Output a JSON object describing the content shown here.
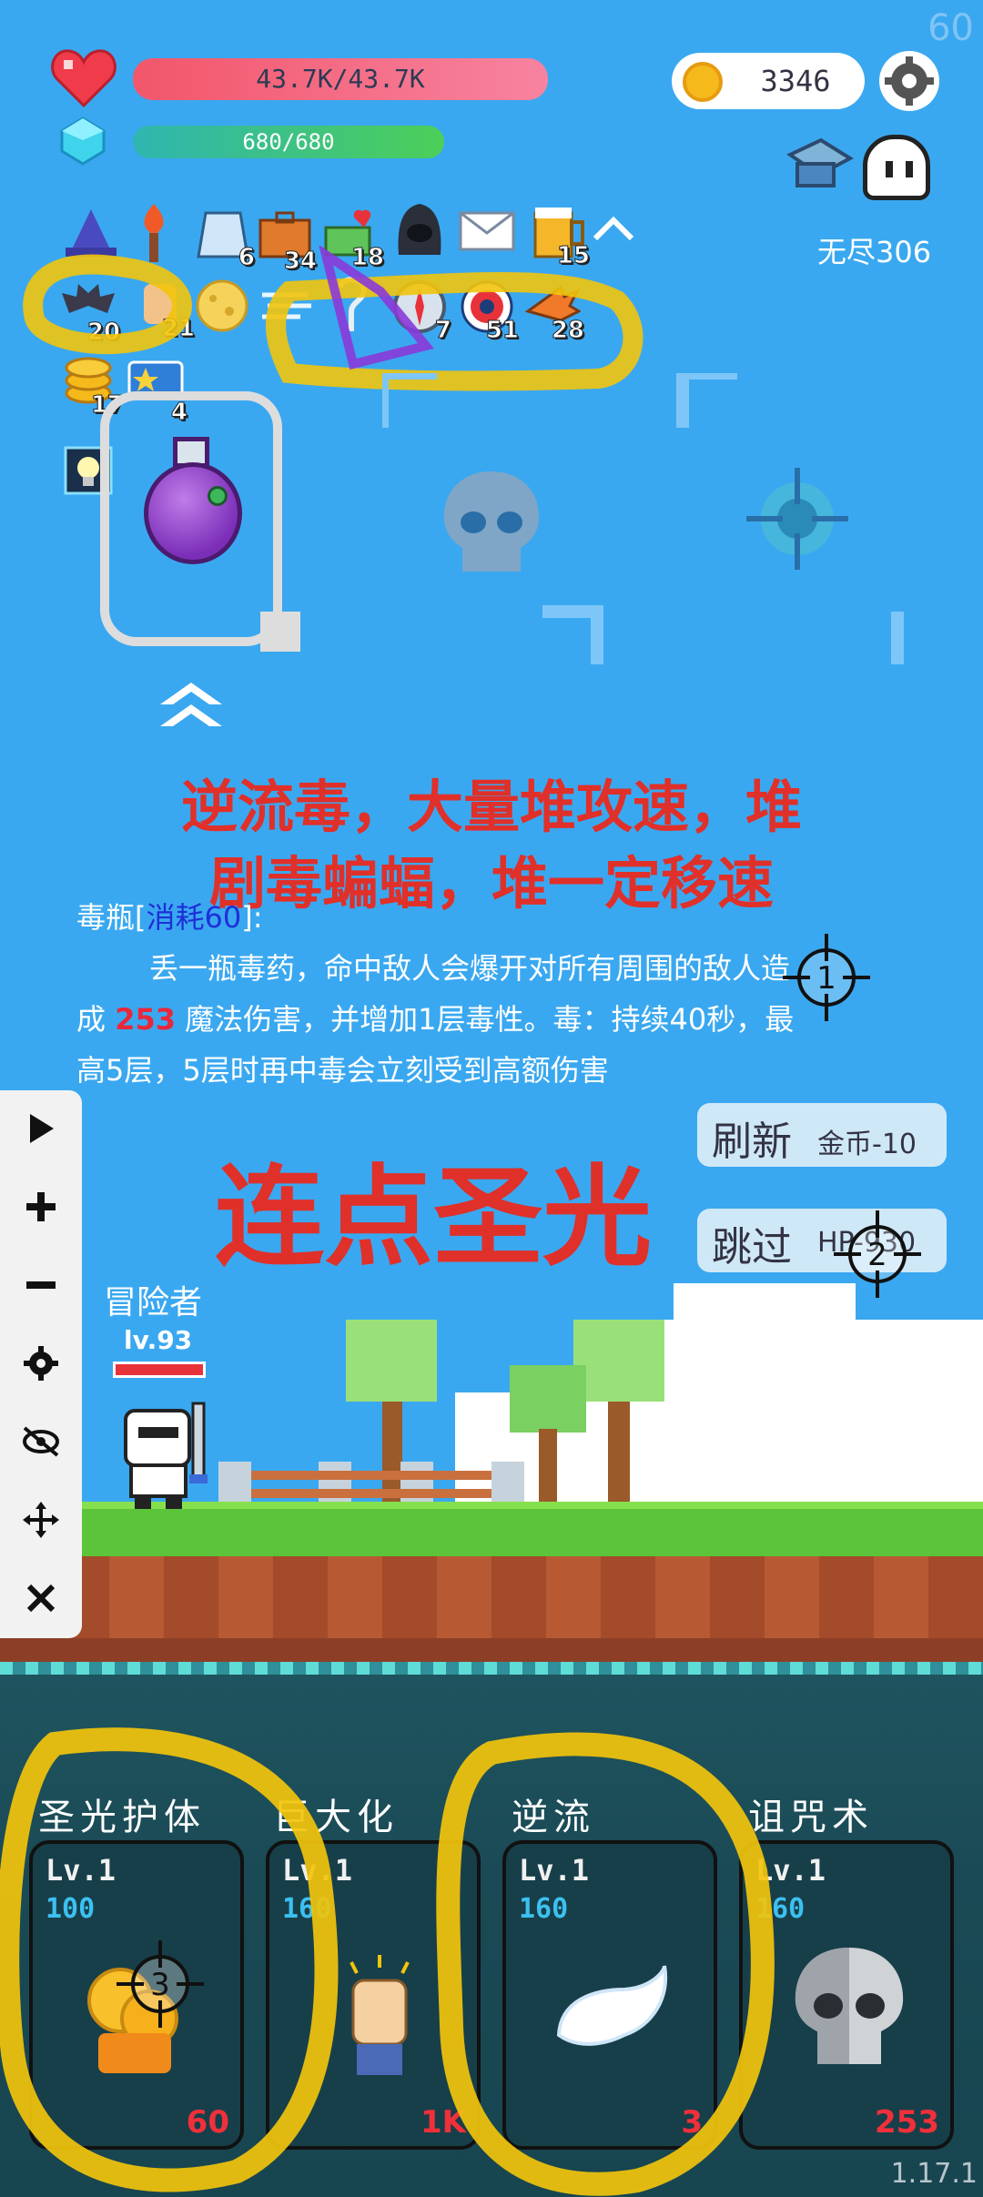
{
  "hud": {
    "fps": "60",
    "hp_text": "43.7K/43.7K",
    "mp_text": "680/680",
    "coins": "3346",
    "mode_label": "无尽306"
  },
  "items_row1": [
    {
      "icon": "wizard-hat-icon",
      "count": ""
    },
    {
      "icon": "flame-staff-icon",
      "count": ""
    },
    {
      "icon": "robe-icon",
      "count": "6"
    },
    {
      "icon": "briefcase-icon",
      "count": "34"
    },
    {
      "icon": "money-heart-icon",
      "count": "18"
    },
    {
      "icon": "hood-icon",
      "count": ""
    },
    {
      "icon": "envelope-icon",
      "count": ""
    },
    {
      "icon": "beer-icon",
      "count": "15"
    }
  ],
  "items_row2": [
    {
      "icon": "bat-icon",
      "count": "20"
    },
    {
      "icon": "fist-icon",
      "count": "21"
    },
    {
      "icon": "moon-cookie-icon",
      "count": ""
    },
    {
      "icon": "wind-icon",
      "count": ""
    },
    {
      "icon": "hook-icon",
      "count": ""
    },
    {
      "icon": "compass-icon",
      "count": "7"
    },
    {
      "icon": "target-icon",
      "count": "51"
    },
    {
      "icon": "arrow-icon",
      "count": "28"
    }
  ],
  "items_row3": [
    {
      "icon": "coin-stack-icon",
      "count": "17"
    },
    {
      "icon": "star-card-icon",
      "count": "4"
    }
  ],
  "annotations": {
    "line1": "逆流毒，大量堆攻速，堆",
    "line2": "剧毒蝙蝠，堆一定移速",
    "line3": "连点圣光",
    "marker1": "1",
    "marker2": "2",
    "marker3": "3"
  },
  "skill_desc": {
    "name": "毒瓶",
    "bracket_open": "[",
    "cost": "消耗60",
    "bracket_close": "]:",
    "text_a": "丢一瓶毒药，命中敌人会爆开对所有周围的敌人造",
    "text_b_prefix": "成 ",
    "damage": "253",
    "text_b_suffix": " 魔法伤害，并增加1层毒性。毒：持续40秒，最",
    "text_c": "高5层，5层时再中毒会立刻受到高额伤害"
  },
  "buttons": {
    "refresh": "刷新",
    "refresh_cost": "金币-10",
    "skip": "跳过",
    "skip_cost": "HP-930"
  },
  "toolbar": [
    "play",
    "plus",
    "minus",
    "gear",
    "eye-off",
    "move",
    "close"
  ],
  "player": {
    "name": "冒险者",
    "level": "lv.93"
  },
  "cards": [
    {
      "title": "圣光护体",
      "lv": "Lv.1",
      "cost": "100",
      "value": "60",
      "icon": "gold-coins-icon"
    },
    {
      "title": "巨大化",
      "lv": "Lv.1",
      "cost": "160",
      "value": "1K",
      "icon": "fist-icon"
    },
    {
      "title": "逆流",
      "lv": "Lv.1",
      "cost": "160",
      "value": "3",
      "icon": "wing-icon"
    },
    {
      "title": "诅咒术",
      "lv": "Lv.1",
      "cost": "160",
      "value": "253",
      "icon": "skull-icon"
    }
  ],
  "version": "1.17.1",
  "colors": {
    "sky": "#3aa8f0",
    "annotation_red": "#e0302a",
    "highlight_yellow": "#f2c40c",
    "damage_red": "#e8283a"
  }
}
